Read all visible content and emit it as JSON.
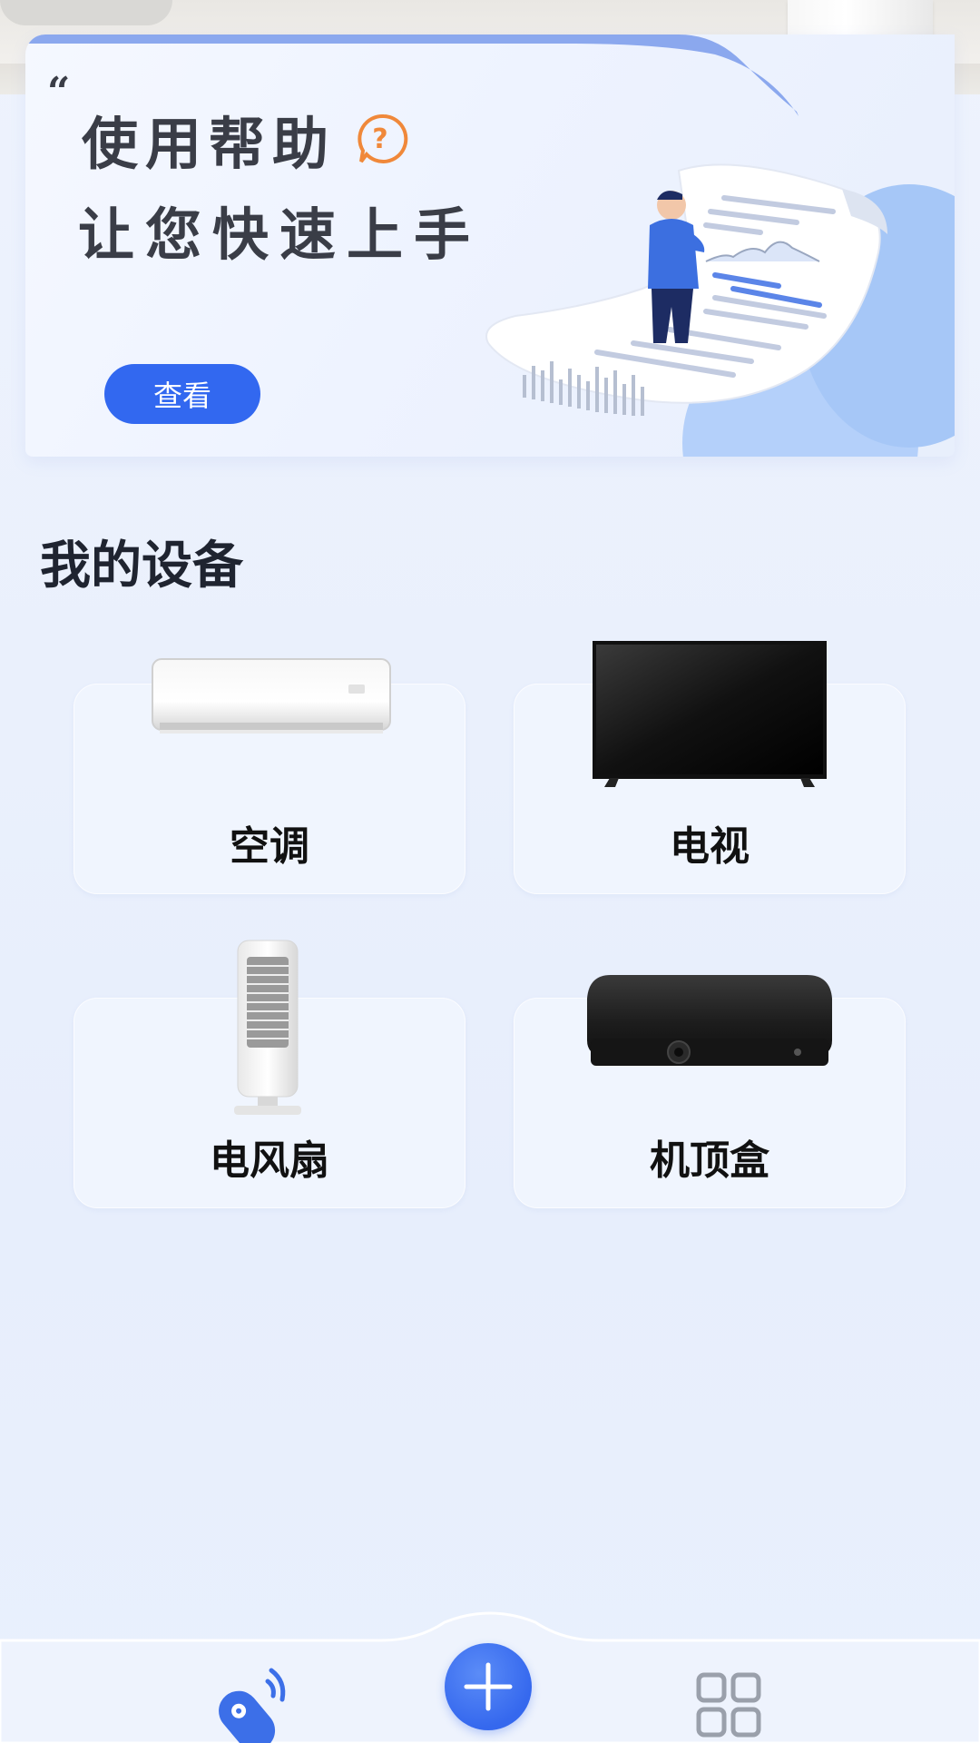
{
  "banner": {
    "title": "使用帮助",
    "subtitle": "让您快速上手",
    "view_button_label": "查看"
  },
  "devices_section": {
    "title": "我的设备",
    "items": [
      {
        "label": "空调",
        "icon": "air-conditioner-image"
      },
      {
        "label": "电视",
        "icon": "tv-image"
      },
      {
        "label": "电风扇",
        "icon": "fan-heater-image"
      },
      {
        "label": "机顶盒",
        "icon": "set-top-box-image"
      }
    ]
  },
  "bottom_nav": {
    "items": [
      {
        "icon": "remote-control-icon"
      },
      {
        "icon": "add-icon"
      },
      {
        "icon": "grid-apps-icon"
      }
    ]
  },
  "colors": {
    "accent": "#3268F0",
    "background": "#EAF0FC",
    "help_icon": "#F0883A"
  }
}
